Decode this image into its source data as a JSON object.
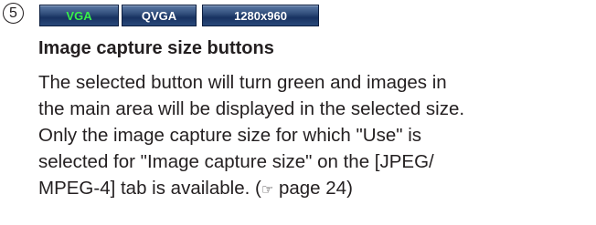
{
  "marker": "5",
  "buttons": [
    {
      "label": "VGA",
      "selected": true
    },
    {
      "label": "QVGA",
      "selected": false
    },
    {
      "label": "1280x960",
      "selected": false
    }
  ],
  "colors": {
    "selected_text": "#38f04a",
    "button_text": "#ffffff",
    "button_bg": "#1e3a6b"
  },
  "heading": "Image capture size buttons",
  "lines": [
    "The selected button will turn green and images in",
    "the main area will be displayed in the selected size.",
    "Only the image capture size for which \"Use\" is",
    "selected for \"Image capture size\" on the [JPEG/",
    "MPEG-4] tab is available. ("
  ],
  "reference_icon": "pointing-hand-icon",
  "reference_text": " page 24)"
}
